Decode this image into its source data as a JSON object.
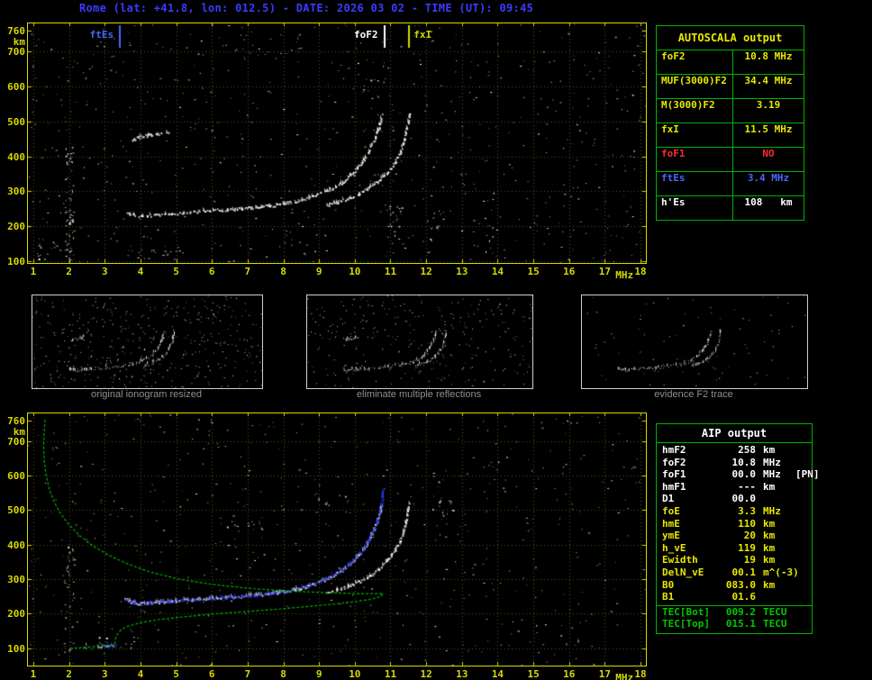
{
  "title": "Rome (lat: +41.8, lon: 012.5) - DATE: 2026 03 02 - TIME (UT): 09:45",
  "colors": {
    "axis": "#d8d800",
    "grid": "#56561c",
    "trace_white": "#ffffff",
    "trace_blue": "#2a3cf0",
    "profile_green": "#00b400",
    "table_border_green": "#00b400",
    "title_blue": "#3b3bff",
    "caption_gray": "#8f8f8f",
    "alert_red": "#ff2a2a"
  },
  "autoscala_table": {
    "title": "AUTOSCALA output",
    "rows": [
      {
        "label": "foF2",
        "value": "10.8 MHz",
        "color": "#e8e800"
      },
      {
        "label": "MUF(3000)F2",
        "value": "34.4 MHz",
        "color": "#e8e800"
      },
      {
        "label": "M(3000)F2",
        "value": "3.19",
        "color": "#e8e800"
      },
      {
        "label": "fxI",
        "value": "11.5 MHz",
        "color": "#e8e800"
      },
      {
        "label": "foF1",
        "value": "NO",
        "color": "#ff2a2a"
      },
      {
        "label": "ftEs",
        "value": "3.4 MHz",
        "color": "#4868ff"
      },
      {
        "label": "h'Es",
        "value": "108   km",
        "color": "#ffffff"
      }
    ]
  },
  "aip_table": {
    "title": "AIP output",
    "rows": [
      {
        "label": "hmF2",
        "value": "258",
        "unit": "km",
        "note": "",
        "color": "#ffffff"
      },
      {
        "label": "foF2",
        "value": "10.8",
        "unit": "MHz",
        "note": "",
        "color": "#ffffff"
      },
      {
        "label": "foF1",
        "value": "00.0",
        "unit": "MHz",
        "note": "[PN]",
        "color": "#ffffff"
      },
      {
        "label": "hmF1",
        "value": "---",
        "unit": "km",
        "note": "",
        "color": "#ffffff"
      },
      {
        "label": "D1",
        "value": "00.0",
        "unit": "",
        "note": "",
        "color": "#ffffff"
      },
      {
        "label": "foE",
        "value": "3.3",
        "unit": "MHz",
        "note": "",
        "color": "#e8e800"
      },
      {
        "label": "hmE",
        "value": "110",
        "unit": "km",
        "note": "",
        "color": "#e8e800"
      },
      {
        "label": "ymE",
        "value": "20",
        "unit": "km",
        "note": "",
        "color": "#e8e800"
      },
      {
        "label": "h_vE",
        "value": "119",
        "unit": "km",
        "note": "",
        "color": "#e8e800"
      },
      {
        "label": "Ewidth",
        "value": "19",
        "unit": "km",
        "note": "",
        "color": "#e8e800"
      },
      {
        "label": "DelN_vE",
        "value": "00.1",
        "unit": "m^(-3)",
        "note": "",
        "color": "#e8e800"
      },
      {
        "label": "B0",
        "value": "083.0",
        "unit": "km",
        "note": "",
        "color": "#e8e800"
      },
      {
        "label": "B1",
        "value": "01.6",
        "unit": "",
        "note": "",
        "color": "#e8e800"
      },
      {
        "label": "TEC[Bot]",
        "value": "009.2",
        "unit": "TECU",
        "note": "",
        "color": "#00c800",
        "sep_above": true
      },
      {
        "label": "TEC[Top]",
        "value": "015.1",
        "unit": "TECU",
        "note": "",
        "color": "#00c800"
      }
    ]
  },
  "thumbnails": [
    {
      "caption": "original ionogram resized",
      "noise": 430,
      "trace_series": [
        0,
        1,
        2
      ]
    },
    {
      "caption": "eliminate multiple reflections",
      "noise": 300,
      "trace_series": [
        0,
        1,
        2
      ]
    },
    {
      "caption": "evidence F2 trace",
      "noise": 80,
      "trace_series": [
        0,
        1
      ]
    }
  ],
  "chart_data": [
    {
      "id": "top",
      "type": "scatter",
      "xlabel": "MHz",
      "ylabel": "km",
      "xlim": [
        0.85,
        18.15
      ],
      "ylim": [
        95,
        780
      ],
      "x_ticks": [
        1,
        2,
        3,
        4,
        5,
        6,
        7,
        8,
        9,
        10,
        11,
        12,
        13,
        14,
        15,
        16,
        17,
        18
      ],
      "y_ticks": [
        100,
        200,
        300,
        400,
        500,
        600,
        700,
        760
      ],
      "grid": true,
      "legend": "none",
      "noise_seed": 11,
      "noise_count": 700,
      "clusters": [
        {
          "f": 2.0,
          "df": 0.12,
          "km": 260,
          "dkm": 170,
          "n": 70
        },
        {
          "f": 1.35,
          "df": 0.3,
          "km": 130,
          "dkm": 40,
          "n": 18
        },
        {
          "f": 11.1,
          "df": 0.25,
          "km": 205,
          "dkm": 60,
          "n": 20
        },
        {
          "f": 12.3,
          "df": 0.2,
          "km": 200,
          "dkm": 45,
          "n": 12
        },
        {
          "f": 13.6,
          "df": 0.3,
          "km": 170,
          "dkm": 50,
          "n": 10
        },
        {
          "f": 10.5,
          "df": 0.35,
          "km": 620,
          "dkm": 55,
          "n": 10
        },
        {
          "f": 4.3,
          "df": 0.8,
          "km": 116,
          "dkm": 18,
          "n": 14
        }
      ],
      "markers": [
        {
          "label": "ftEs",
          "freq": 3.4,
          "color": "#4868ff",
          "side": "left"
        },
        {
          "label": "foF2",
          "freq": 10.8,
          "color": "#ffffff",
          "side": "left"
        },
        {
          "label": "fxI",
          "freq": 11.5,
          "color": "#d8d800",
          "side": "right"
        }
      ],
      "series": [
        {
          "name": "F2 O-trace",
          "style": "dots",
          "color": "#ffffff",
          "points": [
            [
              3.55,
              243
            ],
            [
              3.7,
              237
            ],
            [
              3.85,
              233
            ],
            [
              4.0,
              231
            ],
            [
              4.2,
              232
            ],
            [
              4.5,
              235
            ],
            [
              4.8,
              238
            ],
            [
              5.2,
              241
            ],
            [
              5.6,
              244
            ],
            [
              6.0,
              247
            ],
            [
              6.4,
              249
            ],
            [
              6.8,
              252
            ],
            [
              7.2,
              256
            ],
            [
              7.6,
              260
            ],
            [
              8.0,
              266
            ],
            [
              8.4,
              274
            ],
            [
              8.7,
              283
            ],
            [
              9.0,
              294
            ],
            [
              9.3,
              308
            ],
            [
              9.6,
              325
            ],
            [
              9.85,
              345
            ],
            [
              10.05,
              367
            ],
            [
              10.25,
              392
            ],
            [
              10.4,
              418
            ],
            [
              10.52,
              444
            ],
            [
              10.62,
              470
            ],
            [
              10.69,
              496
            ],
            [
              10.74,
              519
            ]
          ]
        },
        {
          "name": "F2 X-trace",
          "style": "dots",
          "color": "#ffffff",
          "points": [
            [
              9.2,
              263
            ],
            [
              9.5,
              271
            ],
            [
              9.8,
              281
            ],
            [
              10.1,
              294
            ],
            [
              10.4,
              311
            ],
            [
              10.65,
              331
            ],
            [
              10.9,
              356
            ],
            [
              11.1,
              383
            ],
            [
              11.25,
              411
            ],
            [
              11.35,
              440
            ],
            [
              11.42,
              469
            ],
            [
              11.47,
              497
            ],
            [
              11.5,
              520
            ]
          ]
        },
        {
          "name": "second reflection",
          "style": "dots",
          "color": "#ffffff",
          "points": [
            [
              3.75,
              449
            ],
            [
              3.95,
              456
            ],
            [
              4.2,
              462
            ],
            [
              4.5,
              467
            ],
            [
              4.8,
              471
            ]
          ]
        }
      ]
    },
    {
      "id": "bottom",
      "type": "scatter",
      "xlabel": "MHz",
      "ylabel": "km",
      "xlim": [
        0.85,
        18.15
      ],
      "ylim": [
        50,
        780
      ],
      "x_ticks": [
        1,
        2,
        3,
        4,
        5,
        6,
        7,
        8,
        9,
        10,
        11,
        12,
        13,
        14,
        15,
        16,
        17,
        18
      ],
      "y_ticks": [
        100,
        200,
        300,
        400,
        500,
        600,
        700,
        760
      ],
      "grid": true,
      "legend": "none",
      "noise_seed": 12,
      "noise_count": 560,
      "clusters": [
        {
          "f": 2.0,
          "df": 0.15,
          "km": 250,
          "dkm": 160,
          "n": 40
        },
        {
          "f": 12.5,
          "df": 0.35,
          "km": 540,
          "dkm": 55,
          "n": 16
        },
        {
          "f": 13.9,
          "df": 0.3,
          "km": 600,
          "dkm": 50,
          "n": 10
        },
        {
          "f": 6.8,
          "df": 0.6,
          "km": 455,
          "dkm": 18,
          "n": 14
        },
        {
          "f": 3.2,
          "df": 0.9,
          "km": 116,
          "dkm": 18,
          "n": 18
        },
        {
          "f": 15.4,
          "df": 1.2,
          "km": 140,
          "dkm": 45,
          "n": 12
        },
        {
          "f": 9.3,
          "df": 0.5,
          "km": 520,
          "dkm": 30,
          "n": 10
        }
      ],
      "markers": [],
      "series": [
        {
          "name": "F2 O-trace",
          "style": "dots",
          "color": "#ffffff",
          "points": [
            [
              3.55,
              243
            ],
            [
              3.7,
              237
            ],
            [
              3.85,
              233
            ],
            [
              4.0,
              231
            ],
            [
              4.2,
              232
            ],
            [
              4.5,
              235
            ],
            [
              4.8,
              238
            ],
            [
              5.2,
              241
            ],
            [
              5.6,
              244
            ],
            [
              6.0,
              247
            ],
            [
              6.4,
              249
            ],
            [
              6.8,
              252
            ],
            [
              7.2,
              256
            ],
            [
              7.6,
              260
            ],
            [
              8.0,
              266
            ],
            [
              8.4,
              274
            ],
            [
              8.7,
              283
            ],
            [
              9.0,
              294
            ],
            [
              9.3,
              308
            ],
            [
              9.6,
              325
            ],
            [
              9.85,
              345
            ],
            [
              10.05,
              367
            ],
            [
              10.25,
              392
            ],
            [
              10.4,
              418
            ],
            [
              10.52,
              444
            ],
            [
              10.62,
              470
            ],
            [
              10.69,
              496
            ],
            [
              10.74,
              519
            ]
          ]
        },
        {
          "name": "F2 X-trace",
          "style": "dots",
          "color": "#ffffff",
          "points": [
            [
              9.2,
              263
            ],
            [
              9.5,
              271
            ],
            [
              9.8,
              281
            ],
            [
              10.1,
              294
            ],
            [
              10.4,
              311
            ],
            [
              10.65,
              331
            ],
            [
              10.9,
              356
            ],
            [
              11.1,
              383
            ],
            [
              11.25,
              411
            ],
            [
              11.35,
              440
            ],
            [
              11.42,
              469
            ],
            [
              11.47,
              497
            ],
            [
              11.5,
              520
            ]
          ]
        },
        {
          "name": "Es trace",
          "style": "dots",
          "color": "#ffffff",
          "points": [
            [
              2.8,
              108
            ],
            [
              3.0,
              107
            ],
            [
              3.2,
              108
            ]
          ]
        },
        {
          "name": "autoscala restored trace",
          "style": "dots",
          "color": "#2a3cf0",
          "points": [
            [
              3.55,
              243
            ],
            [
              3.7,
              237
            ],
            [
              3.85,
              233
            ],
            [
              4.0,
              231
            ],
            [
              4.2,
              232
            ],
            [
              4.5,
              235
            ],
            [
              4.8,
              238
            ],
            [
              5.2,
              241
            ],
            [
              5.6,
              244
            ],
            [
              6.0,
              247
            ],
            [
              6.4,
              249
            ],
            [
              6.8,
              252
            ],
            [
              7.2,
              256
            ],
            [
              7.6,
              260
            ],
            [
              8.0,
              266
            ],
            [
              8.4,
              274
            ],
            [
              8.7,
              283
            ],
            [
              9.0,
              294
            ],
            [
              9.3,
              308
            ],
            [
              9.6,
              325
            ],
            [
              9.85,
              345
            ],
            [
              10.05,
              367
            ],
            [
              10.25,
              392
            ],
            [
              10.4,
              418
            ],
            [
              10.52,
              444
            ],
            [
              10.62,
              470
            ],
            [
              10.69,
              496
            ],
            [
              10.74,
              519
            ],
            [
              10.77,
              542
            ],
            [
              10.79,
              563
            ]
          ]
        },
        {
          "name": "Es restored",
          "style": "dots",
          "color": "#2a3cf0",
          "points": [
            [
              2.9,
              110
            ],
            [
              3.1,
              109
            ],
            [
              3.3,
              110
            ]
          ]
        },
        {
          "name": "electron density profile",
          "style": "line",
          "color": "#00b400",
          "points": [
            [
              1.33,
              762
            ],
            [
              1.3,
              720
            ],
            [
              1.29,
              680
            ],
            [
              1.31,
              640
            ],
            [
              1.36,
              600
            ],
            [
              1.45,
              560
            ],
            [
              1.58,
              525
            ],
            [
              1.75,
              492
            ],
            [
              1.98,
              460
            ],
            [
              2.28,
              428
            ],
            [
              2.65,
              398
            ],
            [
              3.1,
              370
            ],
            [
              3.65,
              344
            ],
            [
              4.3,
              320
            ],
            [
              5.1,
              300
            ],
            [
              6.0,
              285
            ],
            [
              7.0,
              274
            ],
            [
              8.1,
              266
            ],
            [
              9.2,
              261
            ],
            [
              10.2,
              258
            ],
            [
              10.8,
              258
            ],
            [
              10.72,
              250
            ],
            [
              10.5,
              243
            ],
            [
              10.1,
              236
            ],
            [
              9.5,
              229
            ],
            [
              8.7,
              221
            ],
            [
              7.8,
              213
            ],
            [
              6.9,
              206
            ],
            [
              6.0,
              199
            ],
            [
              5.2,
              191
            ],
            [
              4.5,
              183
            ],
            [
              4.0,
              174
            ],
            [
              3.65,
              164
            ],
            [
              3.45,
              153
            ],
            [
              3.36,
              142
            ],
            [
              3.31,
              131
            ],
            [
              3.29,
              120
            ],
            [
              3.27,
              112
            ],
            [
              3.0,
              107
            ],
            [
              2.5,
              103
            ],
            [
              2.0,
              100
            ]
          ]
        }
      ]
    }
  ]
}
